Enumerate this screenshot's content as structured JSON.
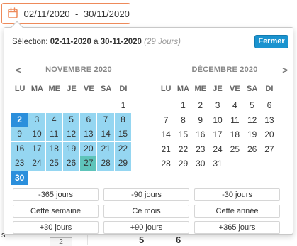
{
  "trigger": {
    "range_text": "02/11/2020  -  30/11/2020",
    "accent": "#ee8a5a"
  },
  "popup": {
    "selection_label": "Sélection:",
    "start": "02-11-2020",
    "to_word": "à",
    "end": "30-11-2020",
    "days": "(29 Jours)",
    "close_label": "Fermer"
  },
  "weekdays": [
    "LU",
    "MA",
    "ME",
    "JE",
    "VE",
    "SA",
    "DI"
  ],
  "months": {
    "left": {
      "title": "NOVEMBRE 2020",
      "prev": "<",
      "offset": 6,
      "days": [
        {
          "n": "1",
          "s": "plain"
        },
        {
          "n": "2",
          "s": "endpoint"
        },
        {
          "n": "3",
          "s": "inrange"
        },
        {
          "n": "4",
          "s": "inrange"
        },
        {
          "n": "5",
          "s": "inrange"
        },
        {
          "n": "6",
          "s": "inrange"
        },
        {
          "n": "7",
          "s": "inrange"
        },
        {
          "n": "8",
          "s": "inrange"
        },
        {
          "n": "9",
          "s": "inrange"
        },
        {
          "n": "10",
          "s": "inrange"
        },
        {
          "n": "11",
          "s": "inrange"
        },
        {
          "n": "12",
          "s": "inrange"
        },
        {
          "n": "13",
          "s": "inrange"
        },
        {
          "n": "14",
          "s": "inrange"
        },
        {
          "n": "15",
          "s": "inrange"
        },
        {
          "n": "16",
          "s": "inrange"
        },
        {
          "n": "17",
          "s": "inrange"
        },
        {
          "n": "18",
          "s": "inrange"
        },
        {
          "n": "19",
          "s": "inrange"
        },
        {
          "n": "20",
          "s": "inrange"
        },
        {
          "n": "21",
          "s": "inrange"
        },
        {
          "n": "22",
          "s": "inrange"
        },
        {
          "n": "23",
          "s": "inrange"
        },
        {
          "n": "24",
          "s": "inrange"
        },
        {
          "n": "25",
          "s": "inrange"
        },
        {
          "n": "26",
          "s": "inrange"
        },
        {
          "n": "27",
          "s": "today"
        },
        {
          "n": "28",
          "s": "inrange"
        },
        {
          "n": "29",
          "s": "inrange"
        },
        {
          "n": "30",
          "s": "endpoint"
        }
      ]
    },
    "right": {
      "title": "DÉCEMBRE 2020",
      "next": ">",
      "offset": 1,
      "days": [
        {
          "n": "1",
          "s": "plain"
        },
        {
          "n": "2",
          "s": "plain"
        },
        {
          "n": "3",
          "s": "plain"
        },
        {
          "n": "4",
          "s": "plain"
        },
        {
          "n": "5",
          "s": "plain"
        },
        {
          "n": "6",
          "s": "plain"
        },
        {
          "n": "7",
          "s": "plain"
        },
        {
          "n": "8",
          "s": "plain"
        },
        {
          "n": "9",
          "s": "plain"
        },
        {
          "n": "10",
          "s": "plain"
        },
        {
          "n": "11",
          "s": "plain"
        },
        {
          "n": "12",
          "s": "plain"
        },
        {
          "n": "13",
          "s": "plain"
        },
        {
          "n": "14",
          "s": "plain"
        },
        {
          "n": "15",
          "s": "plain"
        },
        {
          "n": "16",
          "s": "plain"
        },
        {
          "n": "17",
          "s": "plain"
        },
        {
          "n": "18",
          "s": "plain"
        },
        {
          "n": "19",
          "s": "plain"
        },
        {
          "n": "20",
          "s": "plain"
        },
        {
          "n": "21",
          "s": "plain"
        },
        {
          "n": "22",
          "s": "plain"
        },
        {
          "n": "23",
          "s": "plain"
        },
        {
          "n": "24",
          "s": "plain"
        },
        {
          "n": "25",
          "s": "plain"
        },
        {
          "n": "26",
          "s": "plain"
        },
        {
          "n": "27",
          "s": "plain"
        },
        {
          "n": "28",
          "s": "plain"
        },
        {
          "n": "29",
          "s": "plain"
        },
        {
          "n": "30",
          "s": "plain"
        },
        {
          "n": "31",
          "s": "plain"
        }
      ]
    }
  },
  "presets": [
    "-365 jours",
    "-90 jours",
    "-30 jours",
    "Cette semaine",
    "Ce mois",
    "Cette année",
    "+30 jours",
    "+90 jours",
    "+365 jours"
  ],
  "background": {
    "partial_values": [
      "5",
      "6"
    ],
    "partial_box": "2",
    "partial_left": "s"
  },
  "colors": {
    "range": "#95d6f1",
    "endpoint": "#2b8fdc",
    "today": "#5ec4ba",
    "button": "#1a93cf"
  }
}
